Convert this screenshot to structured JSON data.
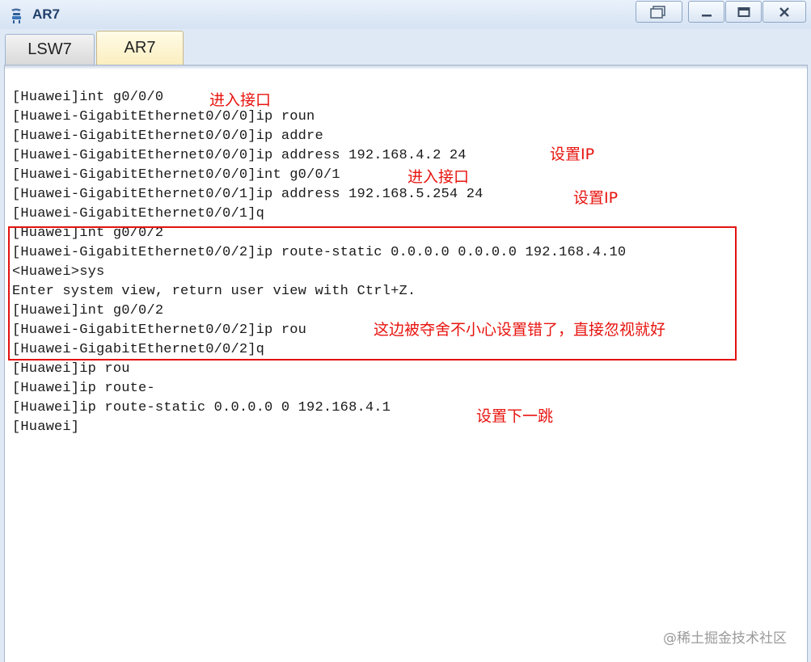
{
  "window": {
    "title": "AR7",
    "icon": "network-device-icon"
  },
  "tabs": [
    {
      "label": "LSW7",
      "active": false
    },
    {
      "label": "AR7",
      "active": true
    }
  ],
  "terminal": {
    "lines": [
      "[Huawei]int g0/0/0",
      "[Huawei-GigabitEthernet0/0/0]ip roun",
      "[Huawei-GigabitEthernet0/0/0]ip addre",
      "[Huawei-GigabitEthernet0/0/0]ip address 192.168.4.2 24",
      "[Huawei-GigabitEthernet0/0/0]int g0/0/1",
      "[Huawei-GigabitEthernet0/0/1]ip address 192.168.5.254 24",
      "[Huawei-GigabitEthernet0/0/1]q",
      "[Huawei]int g0/0/2",
      "[Huawei-GigabitEthernet0/0/2]ip route-static 0.0.0.0 0.0.0.0 192.168.4.10",
      "<Huawei>sys",
      "Enter system view, return user view with Ctrl+Z.",
      "[Huawei]int g0/0/2",
      "[Huawei-GigabitEthernet0/0/2]ip rou",
      "[Huawei-GigabitEthernet0/0/2]q",
      "[Huawei]ip rou",
      "[Huawei]ip route-",
      "[Huawei]ip route-static 0.0.0.0 0 192.168.4.1",
      "[Huawei]"
    ]
  },
  "annotations": {
    "enter_interface_1": "进入接口",
    "set_ip_1": "设置IP",
    "enter_interface_2": "进入接口",
    "set_ip_2": "设置IP",
    "mistake_note": "这边被夺舍不小心设置错了，直接忽视就好",
    "next_hop": "设置下一跳",
    "highlight_color": "#e3130f"
  },
  "watermark": "@稀土掘金技术社区"
}
